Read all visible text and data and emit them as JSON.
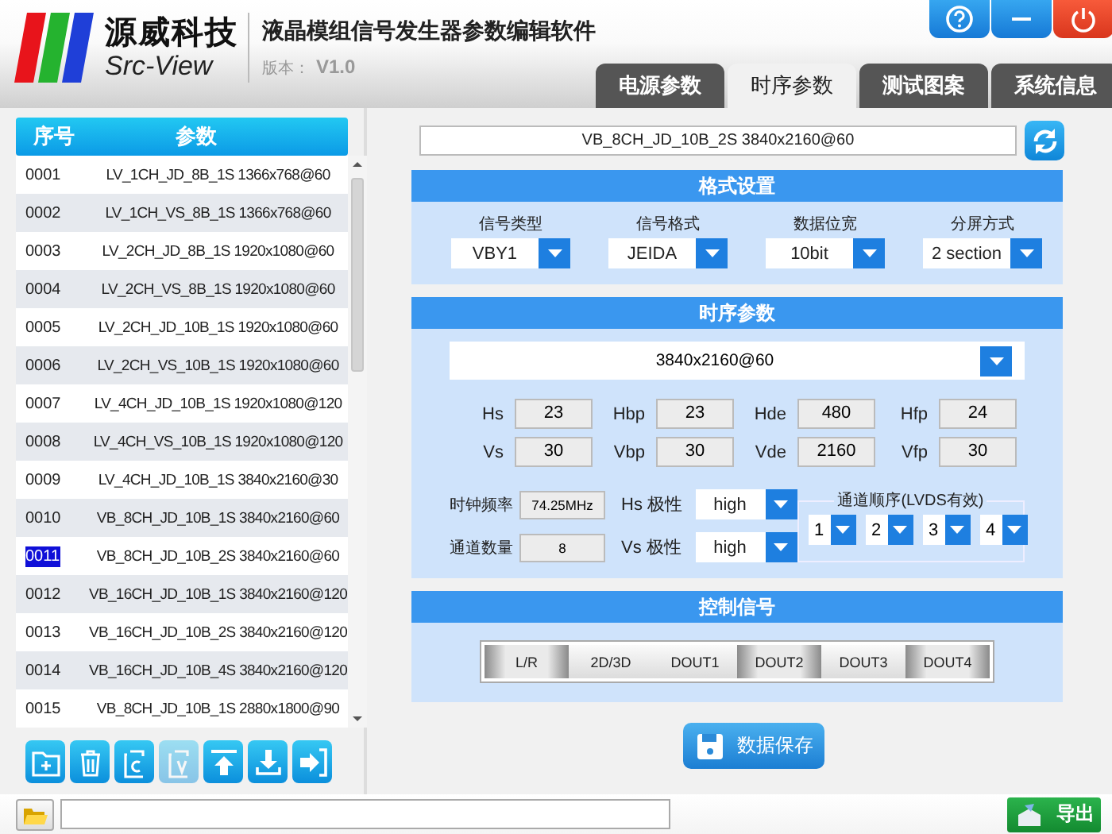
{
  "app": {
    "brand": "源威科技",
    "brand_sub": "Src-View",
    "title": "液晶模组信号发生器参数编辑软件",
    "version_label": "版本：",
    "version": "V1.0"
  },
  "window_buttons": [
    {
      "kind": "help"
    },
    {
      "kind": "minimize"
    },
    {
      "kind": "power"
    }
  ],
  "tabs": [
    {
      "label": "电源参数",
      "selected": false
    },
    {
      "label": "时序参数",
      "selected": true
    },
    {
      "label": "测试图案",
      "selected": false
    },
    {
      "label": "系统信息",
      "selected": false
    }
  ],
  "list": {
    "columns": [
      "序号",
      "参数"
    ],
    "rows": [
      {
        "index": "0001",
        "name": "LV_1CH_JD_8B_1S 1366x768@60",
        "selected": false
      },
      {
        "index": "0002",
        "name": "LV_1CH_VS_8B_1S 1366x768@60",
        "selected": false
      },
      {
        "index": "0003",
        "name": "LV_2CH_JD_8B_1S 1920x1080@60",
        "selected": false
      },
      {
        "index": "0004",
        "name": "LV_2CH_VS_8B_1S 1920x1080@60",
        "selected": false
      },
      {
        "index": "0005",
        "name": "LV_2CH_JD_10B_1S 1920x1080@60",
        "selected": false
      },
      {
        "index": "0006",
        "name": "LV_2CH_VS_10B_1S 1920x1080@60",
        "selected": false
      },
      {
        "index": "0007",
        "name": "LV_4CH_JD_10B_1S 1920x1080@120",
        "selected": false
      },
      {
        "index": "0008",
        "name": "LV_4CH_VS_10B_1S 1920x1080@120",
        "selected": false
      },
      {
        "index": "0009",
        "name": "LV_4CH_JD_10B_1S 3840x2160@30",
        "selected": false
      },
      {
        "index": "0010",
        "name": "VB_8CH_JD_10B_1S 3840x2160@60",
        "selected": false
      },
      {
        "index": "0011",
        "name": "VB_8CH_JD_10B_2S 3840x2160@60",
        "selected": true
      },
      {
        "index": "0012",
        "name": "VB_16CH_JD_10B_1S 3840x2160@120",
        "selected": false
      },
      {
        "index": "0013",
        "name": "VB_16CH_JD_10B_2S 3840x2160@120",
        "selected": false
      },
      {
        "index": "0014",
        "name": "VB_16CH_JD_10B_4S 3840x2160@120",
        "selected": false
      },
      {
        "index": "0015",
        "name": "VB_8CH_JD_10B_1S 2880x1800@90",
        "selected": false
      }
    ]
  },
  "list_tools": [
    {
      "kind": "add",
      "disabled": false
    },
    {
      "kind": "delete",
      "disabled": false
    },
    {
      "kind": "copy",
      "disabled": false
    },
    {
      "kind": "paste",
      "disabled": true
    },
    {
      "kind": "upload",
      "disabled": false
    },
    {
      "kind": "download",
      "disabled": false
    },
    {
      "kind": "import",
      "disabled": false
    }
  ],
  "current_preset": "VB_8CH_JD_10B_2S 3840x2160@60",
  "format": {
    "title": "格式设置",
    "fields": [
      {
        "label": "信号类型",
        "value": "VBY1"
      },
      {
        "label": "信号格式",
        "value": "JEIDA"
      },
      {
        "label": "数据位宽",
        "value": "10bit"
      },
      {
        "label": "分屏方式",
        "value": "2 section"
      }
    ]
  },
  "timing": {
    "title": "时序参数",
    "resolution": "3840x2160@60",
    "params": [
      {
        "label": "Hs",
        "value": "23"
      },
      {
        "label": "Hbp",
        "value": "23"
      },
      {
        "label": "Hde",
        "value": "480"
      },
      {
        "label": "Hfp",
        "value": "24"
      },
      {
        "label": "Vs",
        "value": "30"
      },
      {
        "label": "Vbp",
        "value": "30"
      },
      {
        "label": "Vde",
        "value": "2160"
      },
      {
        "label": "Vfp",
        "value": "30"
      }
    ],
    "clock": {
      "label": "时钟频率",
      "value": "74.25MHz"
    },
    "channels": {
      "label": "通道数量",
      "value": "8"
    },
    "polarity": [
      {
        "label": "Hs 极性",
        "value": "high"
      },
      {
        "label": "Vs 极性",
        "value": "high"
      }
    ],
    "order": {
      "title": "通道顺序(LVDS有效)",
      "values": [
        "1",
        "2",
        "3",
        "4"
      ]
    }
  },
  "control": {
    "title": "控制信号",
    "switches": [
      {
        "label": "L/R",
        "on": true
      },
      {
        "label": "2D/3D",
        "on": false
      },
      {
        "label": "DOUT1",
        "on": false
      },
      {
        "label": "DOUT2",
        "on": true
      },
      {
        "label": "DOUT3",
        "on": false
      },
      {
        "label": "DOUT4",
        "on": true
      }
    ]
  },
  "save_button": "数据保存",
  "status_bar": {
    "export_button": "导出"
  }
}
